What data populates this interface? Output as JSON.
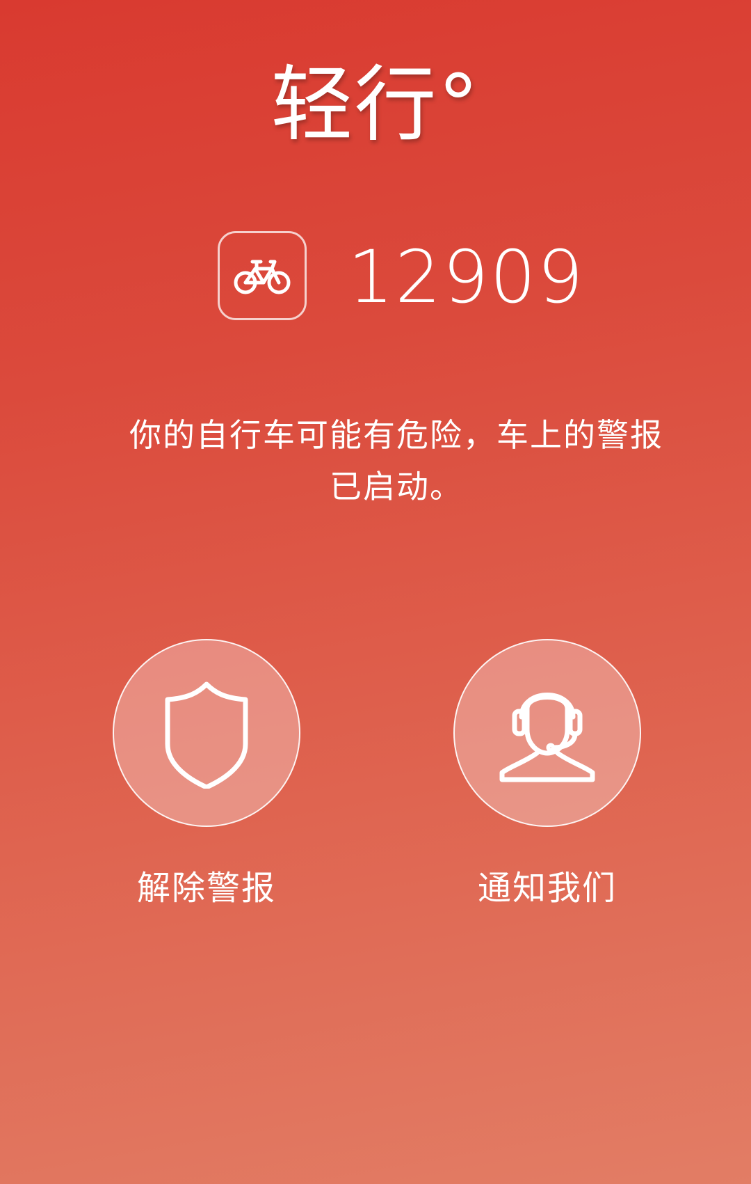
{
  "app": {
    "logo_text": "轻行°"
  },
  "bike": {
    "icon": "bicycle-icon",
    "number": "12909"
  },
  "alert": {
    "message_line1": "你的自行车可能有危险，车上的警报",
    "message_line2": "已启动。"
  },
  "actions": [
    {
      "icon": "shield-icon",
      "label": "解除警报"
    },
    {
      "icon": "customer-service-headset-icon",
      "label": "通知我们"
    }
  ],
  "colors": {
    "background_top": "#d93a30",
    "background_bottom": "#e27d65",
    "foreground": "#ffffff"
  }
}
